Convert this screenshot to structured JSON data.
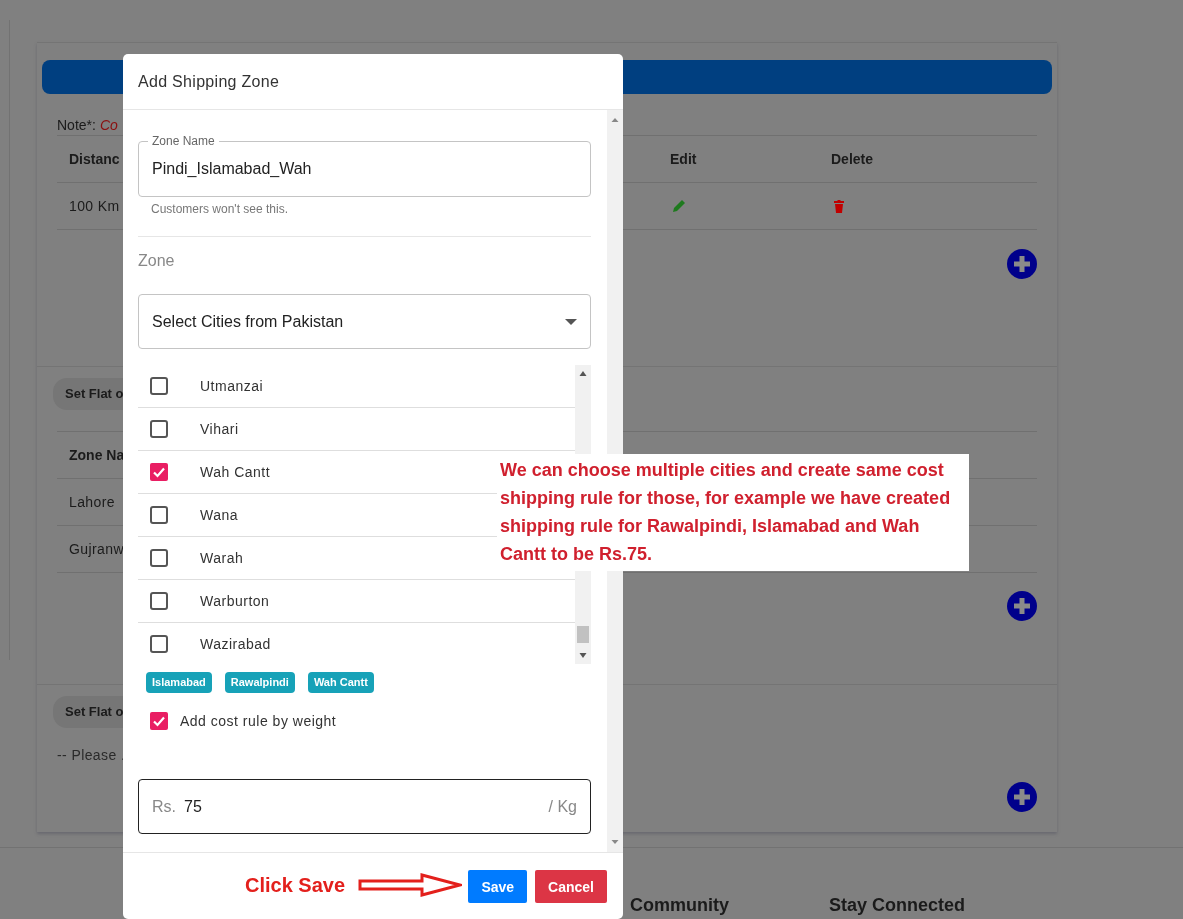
{
  "background_page": {
    "note": {
      "label": "Note*:",
      "text": "Co"
    },
    "distance_table": {
      "columns": [
        "Distanc",
        "Edit",
        "Delete"
      ],
      "rows": [
        {
          "distance": "100 Km"
        }
      ]
    },
    "sections": [
      {
        "button": "Set Flat o",
        "table": {
          "columns": [
            "Zone Na"
          ],
          "rows": [
            {
              "zone": "Lahore"
            },
            {
              "zone": "Gujranw"
            }
          ]
        }
      },
      {
        "button": "Set Flat o",
        "message": "-- Please ."
      }
    ],
    "footer": {
      "headings": [
        "Community",
        "Stay Connected"
      ]
    }
  },
  "dialog": {
    "title": "Add Shipping Zone",
    "zone_name": {
      "label": "Zone Name",
      "value": "Pindi_Islamabad_Wah",
      "helper": "Customers won't see this."
    },
    "zone_label": "Zone",
    "city_select": {
      "label": "Select Cities from Pakistan"
    },
    "cities": [
      {
        "name": "Utmanzai",
        "checked": false
      },
      {
        "name": "Vihari",
        "checked": false
      },
      {
        "name": "Wah Cantt",
        "checked": true
      },
      {
        "name": "Wana",
        "checked": false
      },
      {
        "name": "Warah",
        "checked": false
      },
      {
        "name": "Warburton",
        "checked": false
      },
      {
        "name": "Wazirabad",
        "checked": false
      }
    ],
    "selected_tags": [
      "Islamabad",
      "Rawalpindi",
      "Wah Cantt"
    ],
    "weight_rule": {
      "label": "Add cost rule by weight",
      "checked": true
    },
    "cost_field": {
      "prefix": "Rs.",
      "value": "75",
      "suffix": "/ Kg"
    },
    "buttons": [
      {
        "label": "Save",
        "kind": "primary"
      },
      {
        "label": "Cancel",
        "kind": "danger"
      }
    ]
  },
  "annotations": {
    "note": "We can choose multiple cities and create same cost shipping rule for those, for example we have created shipping rule for Rawalpindi, Islamabad and Wah Cantt to be Rs.75.",
    "click_label": "Click Save"
  }
}
